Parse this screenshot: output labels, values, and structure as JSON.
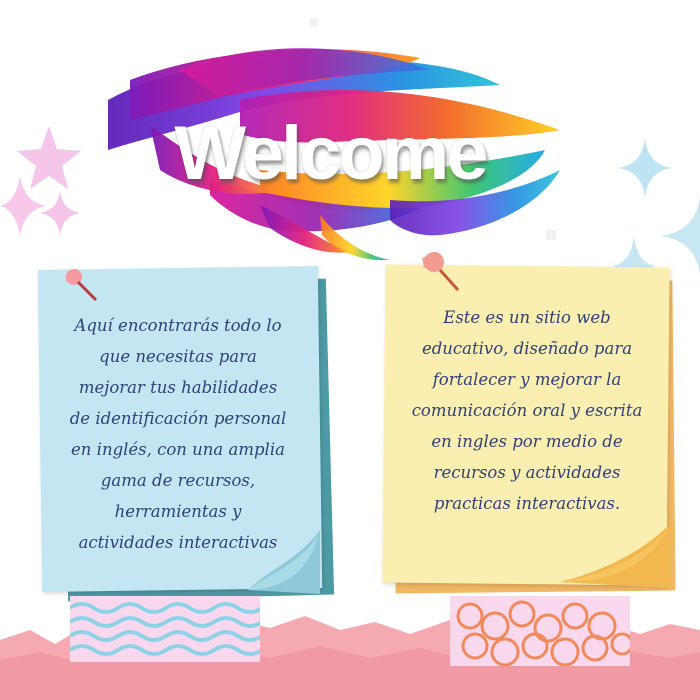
{
  "banner": {
    "title": "Welcome"
  },
  "notes": {
    "left": {
      "lines": [
        "Aquí encontrarás todo lo",
        "que necesitas para",
        "mejorar tus habilidades",
        "de identificación personal",
        "en inglés, con una amplia",
        "gama de recursos,",
        "herramientas y",
        "actividades interactivas"
      ]
    },
    "right": {
      "lines": [
        "Este es un sitio web",
        "educativo, diseñado para",
        "fortalecer y  mejorar la",
        "comunicación oral y escrita",
        "en ingles por medio de",
        "recursos y actividades",
        "practicas interactivas."
      ]
    }
  },
  "colors": {
    "left_note": "#c4e6f2",
    "right_note": "#fbeeb1",
    "text": "#30407a",
    "bottom_band": "#f4a3ad"
  },
  "icons": [
    "pushpin-icon",
    "sparkle-icon",
    "star-icon"
  ]
}
